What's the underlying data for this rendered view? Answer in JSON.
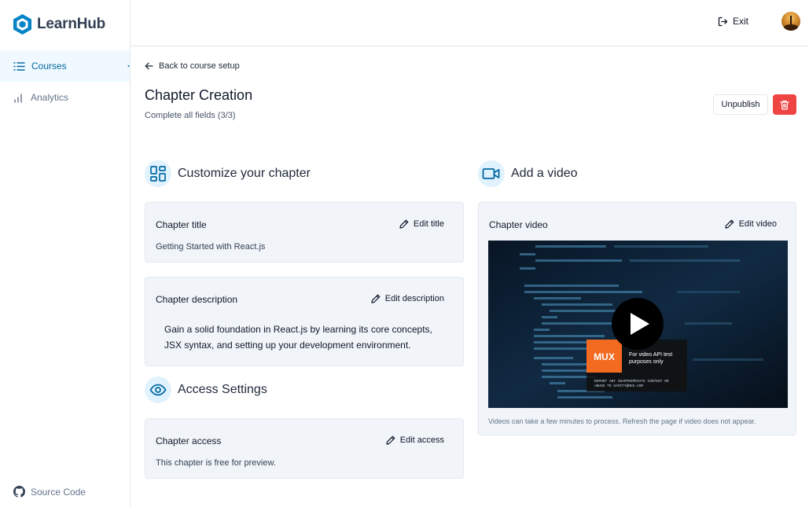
{
  "app": {
    "name": "LearnHub",
    "brand_color": "#0369a1"
  },
  "sidebar": {
    "items": [
      {
        "label": "Courses",
        "icon": "list-icon",
        "active": true
      },
      {
        "label": "Analytics",
        "icon": "bar-chart-icon",
        "active": false
      }
    ],
    "footer": {
      "label": "Source Code",
      "icon": "github-icon"
    }
  },
  "header": {
    "exit_label": "Exit",
    "exit_icon": "log-out-icon"
  },
  "page": {
    "back_label": "Back to course setup",
    "title": "Chapter Creation",
    "subtitle": "Complete all fields (3/3)",
    "unpublish_label": "Unpublish",
    "delete_icon": "trash-icon",
    "delete_color": "#ef4444"
  },
  "customize": {
    "heading": "Customize your chapter",
    "icon": "layout-dashboard-icon",
    "title_card": {
      "label": "Chapter title",
      "action": "Edit title",
      "value": "Getting Started with React.js"
    },
    "description_card": {
      "label": "Chapter description",
      "action": "Edit description",
      "value": "Gain a solid foundation in React.js by learning its core concepts, JSX syntax, and setting up your development environment."
    }
  },
  "access": {
    "heading": "Access Settings",
    "icon": "eye-icon",
    "card": {
      "label": "Chapter access",
      "action": "Edit access",
      "value": "This chapter is free for preview."
    }
  },
  "video": {
    "heading": "Add a video",
    "icon": "video-icon",
    "card": {
      "label": "Chapter video",
      "action": "Edit video",
      "mux_logo": "MUX",
      "mux_text_line1": "For video API test",
      "mux_text_line2": "purposes only",
      "mux_notice_line1": "REPORT ANY INAPPROPRIATE CONTENT OR",
      "mux_notice_line2": "ABUSE TO SAFETY@MUX.COM",
      "note": "Videos can take a few minutes to process. Refresh the page if video does not appear."
    }
  }
}
